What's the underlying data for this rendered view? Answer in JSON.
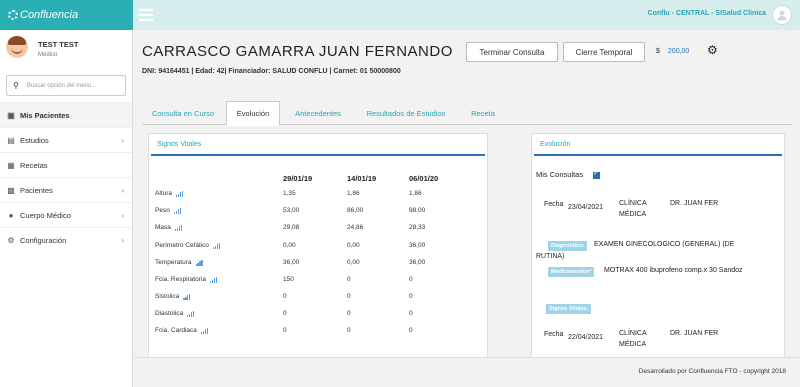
{
  "app": {
    "brand": "Confluencia",
    "top_right": "Conflu - CENTRAL - SISalud Clinica"
  },
  "user": {
    "name": "TEST TEST",
    "role": "Médico"
  },
  "search": {
    "placeholder": "Buscar opción del menu..."
  },
  "sidebar": {
    "items": [
      {
        "label": "Mis Pacientes",
        "icon": "briefcase-icon",
        "active": true
      },
      {
        "label": "Estudios",
        "icon": "file-icon",
        "chevron": true
      },
      {
        "label": "Recetas",
        "icon": "prescription-icon"
      },
      {
        "label": "Pacientes",
        "icon": "id-card-icon",
        "chevron": true
      },
      {
        "label": "Cuerpo Médico",
        "icon": "user-md-icon",
        "chevron": true
      },
      {
        "label": "Configuración",
        "icon": "cogs-icon",
        "chevron": true
      }
    ]
  },
  "patient": {
    "name": "CARRASCO GAMARRA JUAN FERNANDO",
    "info": "DNI: 94164451 | Edad: 42| Financiador: SALUD CONFLU | Carnet: 01 50000800"
  },
  "actions": {
    "end_label": "Terminar Consulta",
    "close_label": "Cierre Temporal",
    "currency": "$",
    "amount": "200,00"
  },
  "tabs": [
    "Consulta en Curso",
    "Evolución",
    "Antecedentes",
    "Resultados de Estudios",
    "Receta"
  ],
  "vitals": {
    "title": "Signos Vitales",
    "dates": [
      "29/01/19",
      "14/01/19",
      "06/01/20"
    ],
    "rows": [
      {
        "label": "Altura",
        "values": [
          "1,35",
          "1,86",
          "1,86"
        ]
      },
      {
        "label": "Peso",
        "values": [
          "53,00",
          "86,00",
          "98,00"
        ]
      },
      {
        "label": "Masa",
        "values": [
          "29,08",
          "24,86",
          "28,33"
        ]
      },
      {
        "label": "Perímetro Cefálico",
        "values": [
          "0,00",
          "0,00",
          "36,00"
        ]
      },
      {
        "label": "Temperatura",
        "values": [
          "36,00",
          "0,00",
          "36,00"
        ]
      },
      {
        "label": "Fcia. Respiratoria",
        "values": [
          "150",
          "0",
          "0"
        ]
      },
      {
        "label": "Sistolica",
        "values": [
          "0",
          "0",
          "0"
        ]
      },
      {
        "label": "Diastolica",
        "values": [
          "0",
          "0",
          "0"
        ]
      },
      {
        "label": "Fcia. Cardiaca",
        "values": [
          "0",
          "0",
          "0"
        ]
      }
    ]
  },
  "evolution": {
    "title": "Evolución",
    "mine_label": "Mis Consultas",
    "entries": [
      {
        "fecha_label": "Fecha",
        "date": "23/04/2021",
        "place1": "CLÍNICA",
        "place2": "MÉDICA",
        "doctor": "DR. JUAN FER",
        "dx_badge": "Diagnóstico:",
        "dx": "EXAMEN GINECOLOGICO (GENERAL) (DE",
        "dx2": "RUTINA)",
        "med_badge": "Medicamentos*",
        "med": "MOTRAX 400 ibuprofeno comp.x 30 Sandoz",
        "vs_badge": "Signos Vitales:"
      },
      {
        "fecha_label": "Fecha",
        "date": "22/04/2021",
        "place1": "CLÍNICA",
        "place2": "MÉDICA",
        "doctor": "DR. JUAN FER"
      }
    ]
  },
  "footer": "Desarrollado por Confluencia FTO - copyright 2018"
}
